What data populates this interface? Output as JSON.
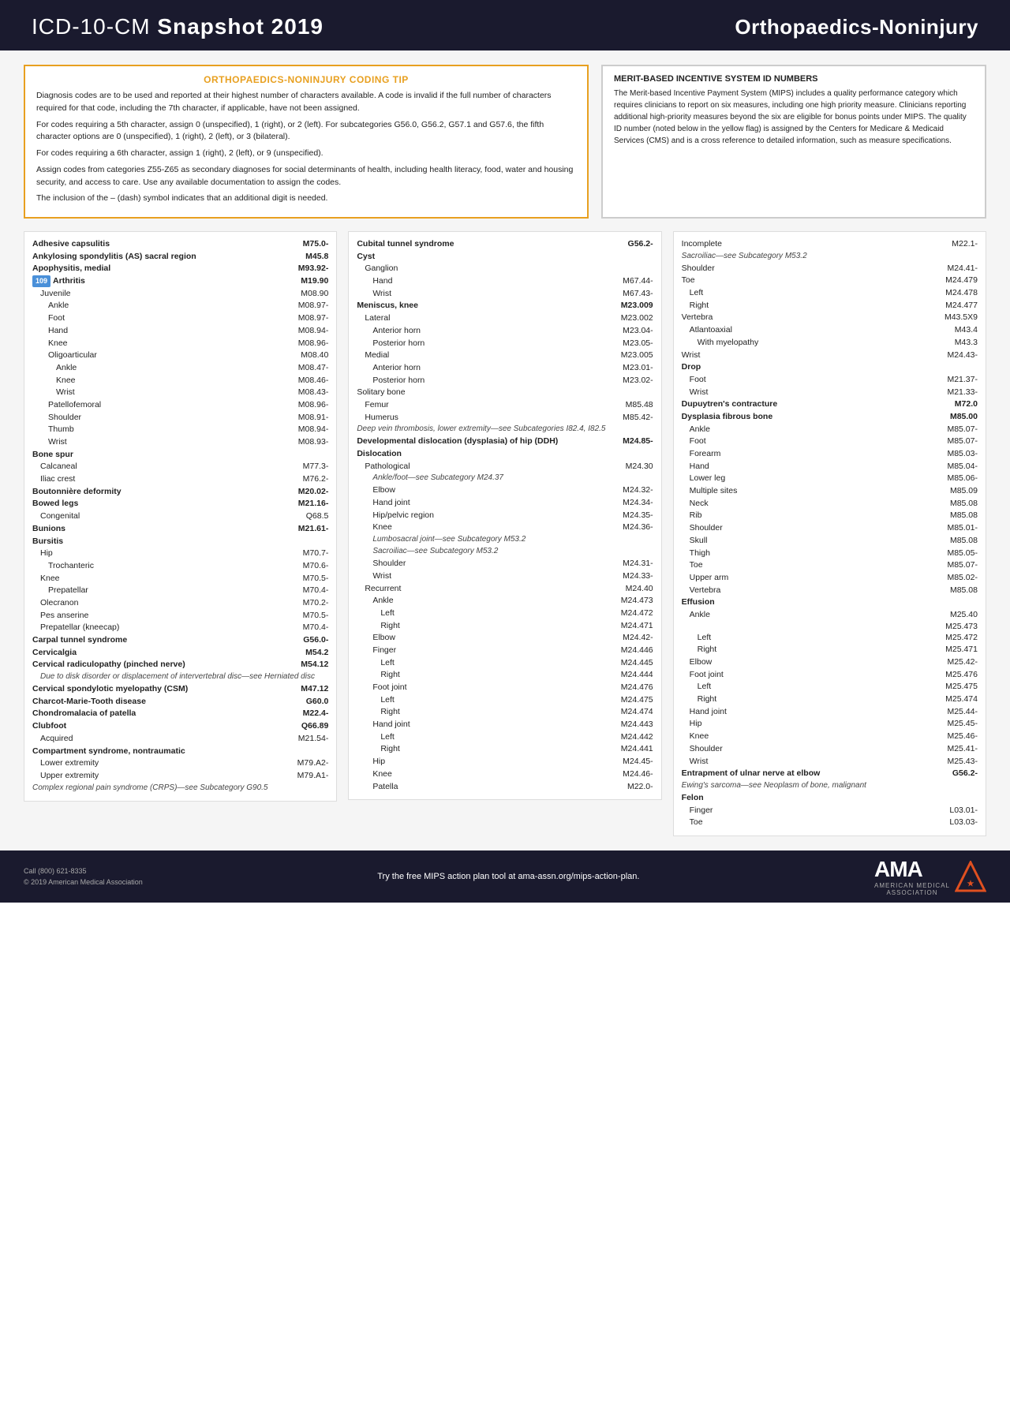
{
  "header": {
    "title_prefix": "ICD-10-CM ",
    "title_bold": "Snapshot 2019",
    "subtitle": "Orthopaedics-Noninjury",
    "dots_left": "• • • • • • • • •",
    "dots_right": "• • • • • • • •"
  },
  "coding_tip": {
    "title": "ORTHOPAEDICS-NONINJURY CODING TIP",
    "paragraphs": [
      "Diagnosis codes are to be used and reported at their highest number of characters available. A code is invalid if the full number of characters required for that code, including the 7th character, if applicable, have not been assigned.",
      "For codes requiring a 5th character, assign 0 (unspecified), 1 (right), or 2 (left). For subcategories G56.0, G56.2, G57.1 and G57.6, the fifth character options are 0 (unspecified), 1 (right), 2 (left), or 3 (bilateral).",
      "For codes requiring a 6th character, assign 1 (right), 2 (left), or 9 (unspecified).",
      "Assign codes from categories Z55-Z65 as secondary diagnoses for social determinants of health, including health literacy, food, water and housing security, and access to care. Use any available documentation to assign the codes.",
      "The inclusion of the – (dash) symbol indicates that an additional digit is needed."
    ]
  },
  "merit": {
    "title": "MERIT-BASED INCENTIVE SYSTEM ID NUMBERS",
    "text": "The Merit-based Incentive Payment System (MIPS) includes a quality performance category which requires clinicians to report on six measures, including one high priority measure. Clinicians reporting additional high-priority measures beyond the six are eligible for bonus points under MIPS. The quality ID number (noted below in the yellow flag) is assigned by the Centers for Medicare & Medicaid Services (CMS) and is a cross reference to detailed information, such as measure specifications."
  },
  "col_left": {
    "entries": [
      {
        "name": "Adhesive capsulitis",
        "code": "M75.0-",
        "bold": true,
        "indent": 0
      },
      {
        "name": "Ankylosing spondylitis (AS) sacral region",
        "code": "M45.8",
        "bold": true,
        "indent": 0
      },
      {
        "name": "Apophysitis, medial",
        "code": "M93.92-",
        "bold": true,
        "indent": 0
      },
      {
        "name": "Arthritis",
        "code": "M19.90",
        "bold": true,
        "indent": 0,
        "mips": "109"
      },
      {
        "name": "Juvenile",
        "code": "M08.90",
        "bold": false,
        "indent": 1
      },
      {
        "name": "Ankle",
        "code": "M08.97-",
        "bold": false,
        "indent": 2
      },
      {
        "name": "Foot",
        "code": "M08.97-",
        "bold": false,
        "indent": 2
      },
      {
        "name": "Hand",
        "code": "M08.94-",
        "bold": false,
        "indent": 2
      },
      {
        "name": "Knee",
        "code": "M08.96-",
        "bold": false,
        "indent": 2
      },
      {
        "name": "Oligoarticular",
        "code": "M08.40",
        "bold": false,
        "indent": 2
      },
      {
        "name": "Ankle",
        "code": "M08.47-",
        "bold": false,
        "indent": 3
      },
      {
        "name": "Knee",
        "code": "M08.46-",
        "bold": false,
        "indent": 3
      },
      {
        "name": "Wrist",
        "code": "M08.43-",
        "bold": false,
        "indent": 3
      },
      {
        "name": "Patellofemoral",
        "code": "M08.96-",
        "bold": false,
        "indent": 2
      },
      {
        "name": "Shoulder",
        "code": "M08.91-",
        "bold": false,
        "indent": 2
      },
      {
        "name": "Thumb",
        "code": "M08.94-",
        "bold": false,
        "indent": 2
      },
      {
        "name": "Wrist",
        "code": "M08.93-",
        "bold": false,
        "indent": 2
      },
      {
        "name": "Bone spur",
        "code": "",
        "bold": true,
        "indent": 0
      },
      {
        "name": "Calcaneal",
        "code": "M77.3-",
        "bold": false,
        "indent": 1
      },
      {
        "name": "Iliac crest",
        "code": "M76.2-",
        "bold": false,
        "indent": 1
      },
      {
        "name": "Boutonnière deformity",
        "code": "M20.02-",
        "bold": true,
        "indent": 0
      },
      {
        "name": "Bowed legs",
        "code": "M21.16-",
        "bold": true,
        "indent": 0
      },
      {
        "name": "Congenital",
        "code": "Q68.5",
        "bold": false,
        "indent": 1
      },
      {
        "name": "Bunions",
        "code": "M21.61-",
        "bold": true,
        "indent": 0
      },
      {
        "name": "Bursitis",
        "code": "",
        "bold": true,
        "indent": 0
      },
      {
        "name": "Hip",
        "code": "M70.7-",
        "bold": false,
        "indent": 1
      },
      {
        "name": "Trochanteric",
        "code": "M70.6-",
        "bold": false,
        "indent": 2
      },
      {
        "name": "Knee",
        "code": "M70.5-",
        "bold": false,
        "indent": 1
      },
      {
        "name": "Prepatellar",
        "code": "M70.4-",
        "bold": false,
        "indent": 2
      },
      {
        "name": "Olecranon",
        "code": "M70.2-",
        "bold": false,
        "indent": 1
      },
      {
        "name": "Pes anserine",
        "code": "M70.5-",
        "bold": false,
        "indent": 1
      },
      {
        "name": "Prepatellar (kneecap)",
        "code": "M70.4-",
        "bold": false,
        "indent": 1
      },
      {
        "name": "Carpal tunnel syndrome",
        "code": "G56.0-",
        "bold": true,
        "indent": 0
      },
      {
        "name": "Cervicalgia",
        "code": "M54.2",
        "bold": true,
        "indent": 0
      },
      {
        "name": "Cervical radiculopathy (pinched nerve)",
        "code": "M54.12",
        "bold": true,
        "indent": 0
      },
      {
        "name": "Due to disk disorder or displacement of intervertebral disc—see Herniated disc",
        "code": "",
        "bold": false,
        "indent": 1,
        "note": true
      },
      {
        "name": "Cervical spondylotic myelopathy (CSM)",
        "code": "M47.12",
        "bold": true,
        "indent": 0
      },
      {
        "name": "Charcot-Marie-Tooth disease",
        "code": "G60.0",
        "bold": true,
        "indent": 0
      },
      {
        "name": "Chondromalacia of patella",
        "code": "M22.4-",
        "bold": true,
        "indent": 0
      },
      {
        "name": "Clubfoot",
        "code": "Q66.89",
        "bold": true,
        "indent": 0
      },
      {
        "name": "Acquired",
        "code": "M21.54-",
        "bold": false,
        "indent": 1
      },
      {
        "name": "Compartment syndrome, nontraumatic",
        "code": "",
        "bold": true,
        "indent": 0
      },
      {
        "name": "Lower extremity",
        "code": "M79.A2-",
        "bold": false,
        "indent": 1
      },
      {
        "name": "Upper extremity",
        "code": "M79.A1-",
        "bold": false,
        "indent": 1
      },
      {
        "name": "Complex regional pain syndrome (CRPS)—see Subcategory G90.5",
        "code": "",
        "bold": true,
        "indent": 0,
        "note": true
      }
    ]
  },
  "col_mid": {
    "entries": [
      {
        "name": "Cubital tunnel syndrome",
        "code": "G56.2-",
        "bold": true,
        "indent": 0
      },
      {
        "name": "Cyst",
        "code": "",
        "bold": true,
        "indent": 0
      },
      {
        "name": "Ganglion",
        "code": "",
        "bold": false,
        "indent": 1
      },
      {
        "name": "Hand",
        "code": "M67.44-",
        "bold": false,
        "indent": 2
      },
      {
        "name": "Wrist",
        "code": "M67.43-",
        "bold": false,
        "indent": 2
      },
      {
        "name": "Meniscus, knee",
        "code": "M23.009",
        "bold": true,
        "indent": 0
      },
      {
        "name": "Lateral",
        "code": "M23.002",
        "bold": false,
        "indent": 1
      },
      {
        "name": "Anterior horn",
        "code": "M23.04-",
        "bold": false,
        "indent": 2
      },
      {
        "name": "Posterior horn",
        "code": "M23.05-",
        "bold": false,
        "indent": 2
      },
      {
        "name": "Medial",
        "code": "M23.005",
        "bold": false,
        "indent": 1
      },
      {
        "name": "Anterior horn",
        "code": "M23.01-",
        "bold": false,
        "indent": 2
      },
      {
        "name": "Posterior horn",
        "code": "M23.02-",
        "bold": false,
        "indent": 2
      },
      {
        "name": "Solitary bone",
        "code": "",
        "bold": false,
        "indent": 0
      },
      {
        "name": "Femur",
        "code": "M85.48",
        "bold": false,
        "indent": 1
      },
      {
        "name": "Humerus",
        "code": "M85.42-",
        "bold": false,
        "indent": 1
      },
      {
        "name": "Deep vein thrombosis, lower extremity—see Subcategories I82.4, I82.5",
        "code": "",
        "bold": true,
        "indent": 0,
        "note": true
      },
      {
        "name": "Developmental dislocation (dysplasia) of hip (DDH)",
        "code": "M24.85-",
        "bold": true,
        "indent": 0
      },
      {
        "name": "Dislocation",
        "code": "",
        "bold": true,
        "indent": 0
      },
      {
        "name": "Pathological",
        "code": "M24.30",
        "bold": false,
        "indent": 1
      },
      {
        "name": "Ankle/foot—see Subcategory M24.37",
        "code": "",
        "bold": false,
        "indent": 2,
        "note": true
      },
      {
        "name": "Elbow",
        "code": "M24.32-",
        "bold": false,
        "indent": 2
      },
      {
        "name": "Hand joint",
        "code": "M24.34-",
        "bold": false,
        "indent": 2
      },
      {
        "name": "Hip/pelvic region",
        "code": "M24.35-",
        "bold": false,
        "indent": 2
      },
      {
        "name": "Knee",
        "code": "M24.36-",
        "bold": false,
        "indent": 2
      },
      {
        "name": "Lumbosacral joint—see Subcategory M53.2",
        "code": "",
        "bold": false,
        "indent": 2,
        "note": true
      },
      {
        "name": "Sacroiliac—see Subcategory M53.2",
        "code": "",
        "bold": false,
        "indent": 2,
        "note": true
      },
      {
        "name": "Shoulder",
        "code": "M24.31-",
        "bold": false,
        "indent": 2
      },
      {
        "name": "Wrist",
        "code": "M24.33-",
        "bold": false,
        "indent": 2
      },
      {
        "name": "Recurrent",
        "code": "M24.40",
        "bold": false,
        "indent": 1
      },
      {
        "name": "Ankle",
        "code": "M24.473",
        "bold": false,
        "indent": 2
      },
      {
        "name": "Left",
        "code": "M24.472",
        "bold": false,
        "indent": 3
      },
      {
        "name": "Right",
        "code": "M24.471",
        "bold": false,
        "indent": 3
      },
      {
        "name": "Elbow",
        "code": "M24.42-",
        "bold": false,
        "indent": 2
      },
      {
        "name": "Finger",
        "code": "M24.446",
        "bold": false,
        "indent": 2
      },
      {
        "name": "Left",
        "code": "M24.445",
        "bold": false,
        "indent": 3
      },
      {
        "name": "Right",
        "code": "M24.444",
        "bold": false,
        "indent": 3
      },
      {
        "name": "Foot joint",
        "code": "M24.476",
        "bold": false,
        "indent": 2
      },
      {
        "name": "Left",
        "code": "M24.475",
        "bold": false,
        "indent": 3
      },
      {
        "name": "Right",
        "code": "M24.474",
        "bold": false,
        "indent": 3
      },
      {
        "name": "Hand joint",
        "code": "M24.443",
        "bold": false,
        "indent": 2
      },
      {
        "name": "Left",
        "code": "M24.442",
        "bold": false,
        "indent": 3
      },
      {
        "name": "Right",
        "code": "M24.441",
        "bold": false,
        "indent": 3
      },
      {
        "name": "Hip",
        "code": "M24.45-",
        "bold": false,
        "indent": 2
      },
      {
        "name": "Knee",
        "code": "M24.46-",
        "bold": false,
        "indent": 2
      },
      {
        "name": "Patella",
        "code": "M22.0-",
        "bold": false,
        "indent": 2
      }
    ]
  },
  "col_right": {
    "entries": [
      {
        "name": "Incomplete",
        "code": "M22.1-",
        "bold": false,
        "indent": 0
      },
      {
        "name": "Sacroiliac—see Subcategory M53.2",
        "code": "",
        "bold": false,
        "indent": 0,
        "note": true
      },
      {
        "name": "Shoulder",
        "code": "M24.41-",
        "bold": false,
        "indent": 0
      },
      {
        "name": "Toe",
        "code": "M24.479",
        "bold": false,
        "indent": 0
      },
      {
        "name": "Left",
        "code": "M24.478",
        "bold": false,
        "indent": 1
      },
      {
        "name": "Right",
        "code": "M24.477",
        "bold": false,
        "indent": 1
      },
      {
        "name": "Vertebra",
        "code": "M43.5X9",
        "bold": false,
        "indent": 0
      },
      {
        "name": "Atlantoaxial",
        "code": "M43.4",
        "bold": false,
        "indent": 1
      },
      {
        "name": "With myelopathy",
        "code": "M43.3",
        "bold": false,
        "indent": 2
      },
      {
        "name": "Wrist",
        "code": "M24.43-",
        "bold": false,
        "indent": 0
      },
      {
        "name": "Drop",
        "code": "",
        "bold": true,
        "indent": 0
      },
      {
        "name": "Foot",
        "code": "M21.37-",
        "bold": false,
        "indent": 1
      },
      {
        "name": "Wrist",
        "code": "M21.33-",
        "bold": false,
        "indent": 1
      },
      {
        "name": "Dupuytren's contracture",
        "code": "M72.0",
        "bold": true,
        "indent": 0
      },
      {
        "name": "Dysplasia fibrous bone",
        "code": "M85.00",
        "bold": true,
        "indent": 0
      },
      {
        "name": "Ankle",
        "code": "M85.07-",
        "bold": false,
        "indent": 1
      },
      {
        "name": "Foot",
        "code": "M85.07-",
        "bold": false,
        "indent": 1
      },
      {
        "name": "Forearm",
        "code": "M85.03-",
        "bold": false,
        "indent": 1
      },
      {
        "name": "Hand",
        "code": "M85.04-",
        "bold": false,
        "indent": 1
      },
      {
        "name": "Lower leg",
        "code": "M85.06-",
        "bold": false,
        "indent": 1
      },
      {
        "name": "Multiple sites",
        "code": "M85.09",
        "bold": false,
        "indent": 1
      },
      {
        "name": "Neck",
        "code": "M85.08",
        "bold": false,
        "indent": 1
      },
      {
        "name": "Rib",
        "code": "M85.08",
        "bold": false,
        "indent": 1
      },
      {
        "name": "Shoulder",
        "code": "M85.01-",
        "bold": false,
        "indent": 1
      },
      {
        "name": "Skull",
        "code": "M85.08",
        "bold": false,
        "indent": 1
      },
      {
        "name": "Thigh",
        "code": "M85.05-",
        "bold": false,
        "indent": 1
      },
      {
        "name": "Toe",
        "code": "M85.07-",
        "bold": false,
        "indent": 1
      },
      {
        "name": "Upper arm",
        "code": "M85.02-",
        "bold": false,
        "indent": 1
      },
      {
        "name": "Vertebra",
        "code": "M85.08",
        "bold": false,
        "indent": 1
      },
      {
        "name": "Effusion",
        "code": "",
        "bold": true,
        "indent": 0
      },
      {
        "name": "Ankle",
        "code": "M25.40",
        "bold": false,
        "indent": 1
      },
      {
        "name": "",
        "code": "M25.473",
        "bold": false,
        "indent": 1
      },
      {
        "name": "Left",
        "code": "M25.472",
        "bold": false,
        "indent": 2
      },
      {
        "name": "Right",
        "code": "M25.471",
        "bold": false,
        "indent": 2
      },
      {
        "name": "Elbow",
        "code": "M25.42-",
        "bold": false,
        "indent": 1
      },
      {
        "name": "Foot joint",
        "code": "M25.476",
        "bold": false,
        "indent": 1
      },
      {
        "name": "Left",
        "code": "M25.475",
        "bold": false,
        "indent": 2
      },
      {
        "name": "Right",
        "code": "M25.474",
        "bold": false,
        "indent": 2
      },
      {
        "name": "Hand joint",
        "code": "M25.44-",
        "bold": false,
        "indent": 1
      },
      {
        "name": "Hip",
        "code": "M25.45-",
        "bold": false,
        "indent": 1
      },
      {
        "name": "Knee",
        "code": "M25.46-",
        "bold": false,
        "indent": 1
      },
      {
        "name": "Shoulder",
        "code": "M25.41-",
        "bold": false,
        "indent": 1
      },
      {
        "name": "Wrist",
        "code": "M25.43-",
        "bold": false,
        "indent": 1
      },
      {
        "name": "Entrapment of ulnar nerve at elbow",
        "code": "G56.2-",
        "bold": true,
        "indent": 0
      },
      {
        "name": "Ewing's sarcoma—see Neoplasm of bone, malignant",
        "code": "",
        "bold": true,
        "indent": 0,
        "note": true
      },
      {
        "name": "Felon",
        "code": "",
        "bold": true,
        "indent": 0
      },
      {
        "name": "Finger",
        "code": "L03.01-",
        "bold": false,
        "indent": 1
      },
      {
        "name": "Toe",
        "code": "L03.03-",
        "bold": false,
        "indent": 1
      }
    ]
  },
  "footer": {
    "phone": "Call (800) 621-8335",
    "copyright": "© 2019 American Medical Association",
    "cta": "Try the free MIPS action plan tool at ama-assn.org/mips-action-plan.",
    "ama_label": "AMA",
    "ama_sub1": "AMERICAN MEDICAL",
    "ama_sub2": "ASSOCIATION"
  }
}
